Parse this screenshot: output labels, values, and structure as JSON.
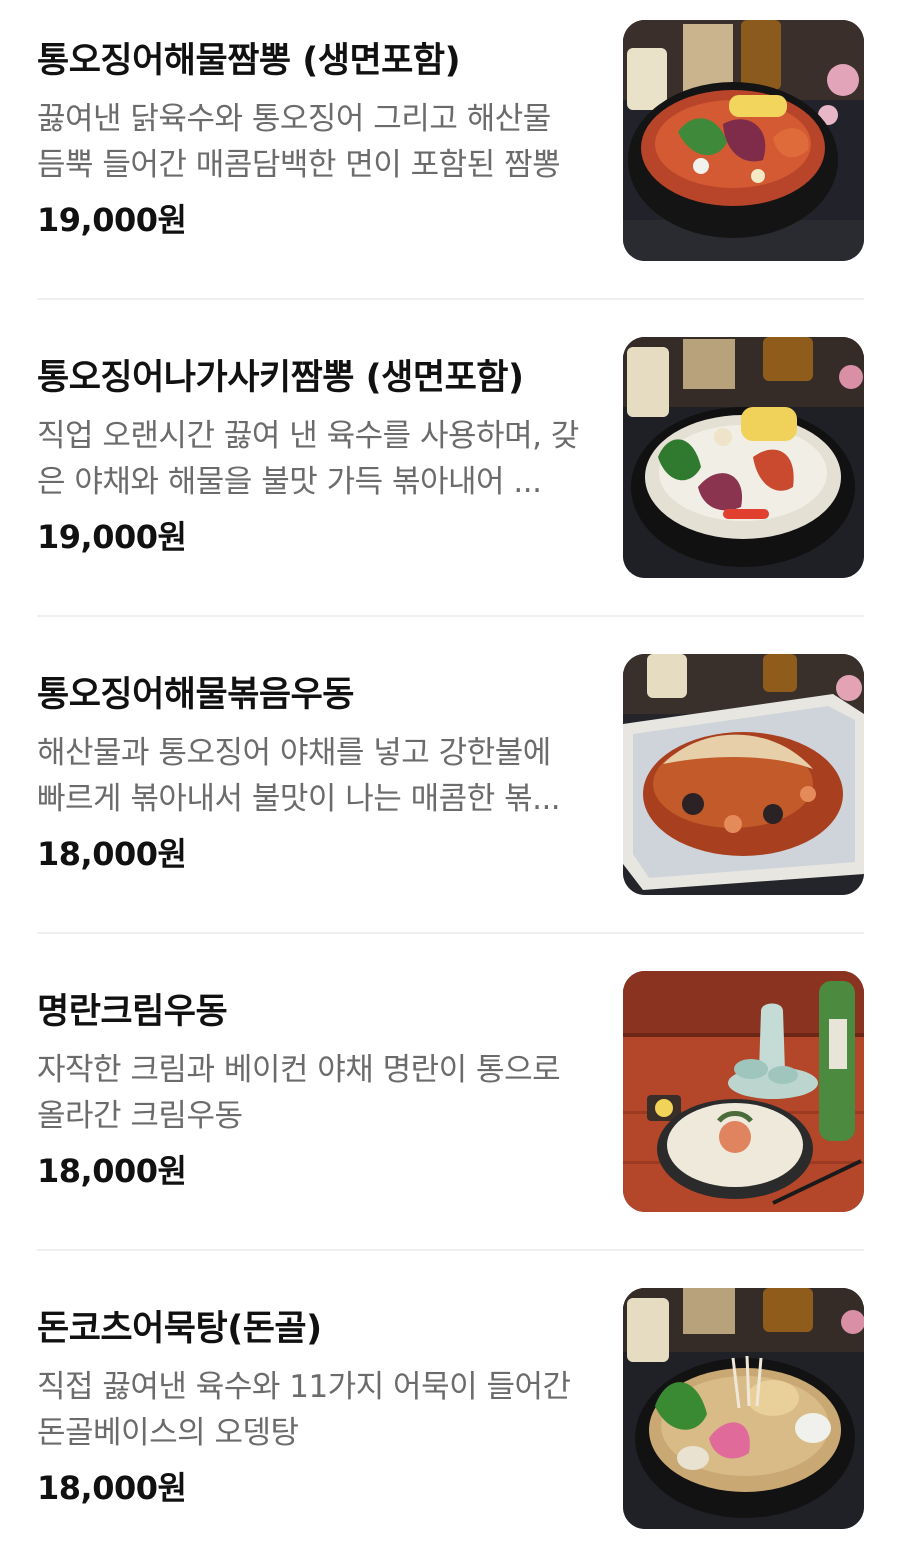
{
  "menu": {
    "items": [
      {
        "title": "통오징어해물짬뽕 (생면포함)",
        "description": "끓여낸 닭육수와 통오징어 그리고 해산물 듬뿍 들어간 매콤담백한 면이 포함된 짬뽕",
        "price": "19,000원",
        "photo": "spicy-seafood-champon-photo"
      },
      {
        "title": "통오징어나가사키짬뽕 (생면포함)",
        "description": "직업 오랜시간 끓여 낸 육수를 사용하며, 갖은 야채와 해물을 불맛 가득 볶아내어 ...",
        "price": "19,000원",
        "photo": "nagasaki-champon-photo"
      },
      {
        "title": "통오징어해물볶음우동",
        "description": "해산물과 통오징어 야채를 넣고 강한불에 빠르게 볶아내서 불맛이 나는 매콤한 볶...",
        "price": "18,000원",
        "photo": "stir-fried-udon-photo"
      },
      {
        "title": "명란크림우동",
        "description": "자작한 크림과 베이컨 야채 명란이 통으로 올라간 크림우동",
        "price": "18,000원",
        "photo": "mentaiko-cream-udon-photo"
      },
      {
        "title": "돈코츠어묵탕(돈골)",
        "description": "직접 끓여낸 육수와 11가지 어묵이 들어간 돈골베이스의 오뎅탕",
        "price": "18,000원",
        "photo": "tonkotsu-oden-photo"
      }
    ]
  }
}
